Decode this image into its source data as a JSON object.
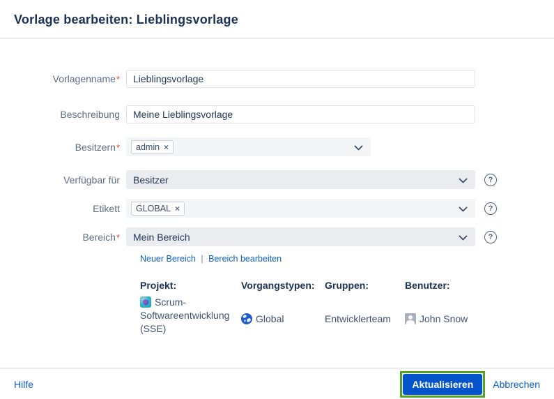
{
  "dialog": {
    "title": "Vorlage bearbeiten: Lieblingsvorlage"
  },
  "required_marker": "*",
  "form": {
    "vorlagenname": {
      "label": "Vorlagenname",
      "value": "Lieblingsvorlage"
    },
    "beschreibung": {
      "label": "Beschreibung",
      "value": "Meine Lieblingsvorlage"
    },
    "besitzern": {
      "label": "Besitzern",
      "tag": "admin",
      "remove": "×"
    },
    "verfuegbar_fuer": {
      "label": "Verfügbar für",
      "value": "Besitzer"
    },
    "etikett": {
      "label": "Etikett",
      "tag": "GLOBAL",
      "remove": "×"
    },
    "bereich": {
      "label": "Bereich",
      "value": "Mein Bereich"
    },
    "bereich_links": {
      "neuer_bereich": "Neuer Bereich",
      "separator": "|",
      "bereich_bearbeiten": "Bereich bearbeiten"
    },
    "help_glyph": "?"
  },
  "info": {
    "projekt": {
      "header": "Projekt:",
      "value": "Scrum-Softwareentwicklung (SSE)"
    },
    "vorgangstypen": {
      "header": "Vorgangstypen:",
      "value": "Global"
    },
    "gruppen": {
      "header": "Gruppen:",
      "value": "Entwicklerteam"
    },
    "benutzer": {
      "header": "Benutzer:",
      "value": "John Snow"
    }
  },
  "footer": {
    "hilfe": "Hilfe",
    "aktualisieren": "Aktualisieren",
    "abbrechen": "Abbrechen"
  },
  "colors": {
    "primary_blue": "#0453CB",
    "annotation_green": "#54A226",
    "title_navy": "#1B3156",
    "label_gray": "#5E6C84",
    "required_red": "#E0442C",
    "field_gray": "#EBECF0",
    "field_light": "#F4F5F7",
    "divider": "#EBECF0",
    "link_blue": "#0B5FD2"
  }
}
